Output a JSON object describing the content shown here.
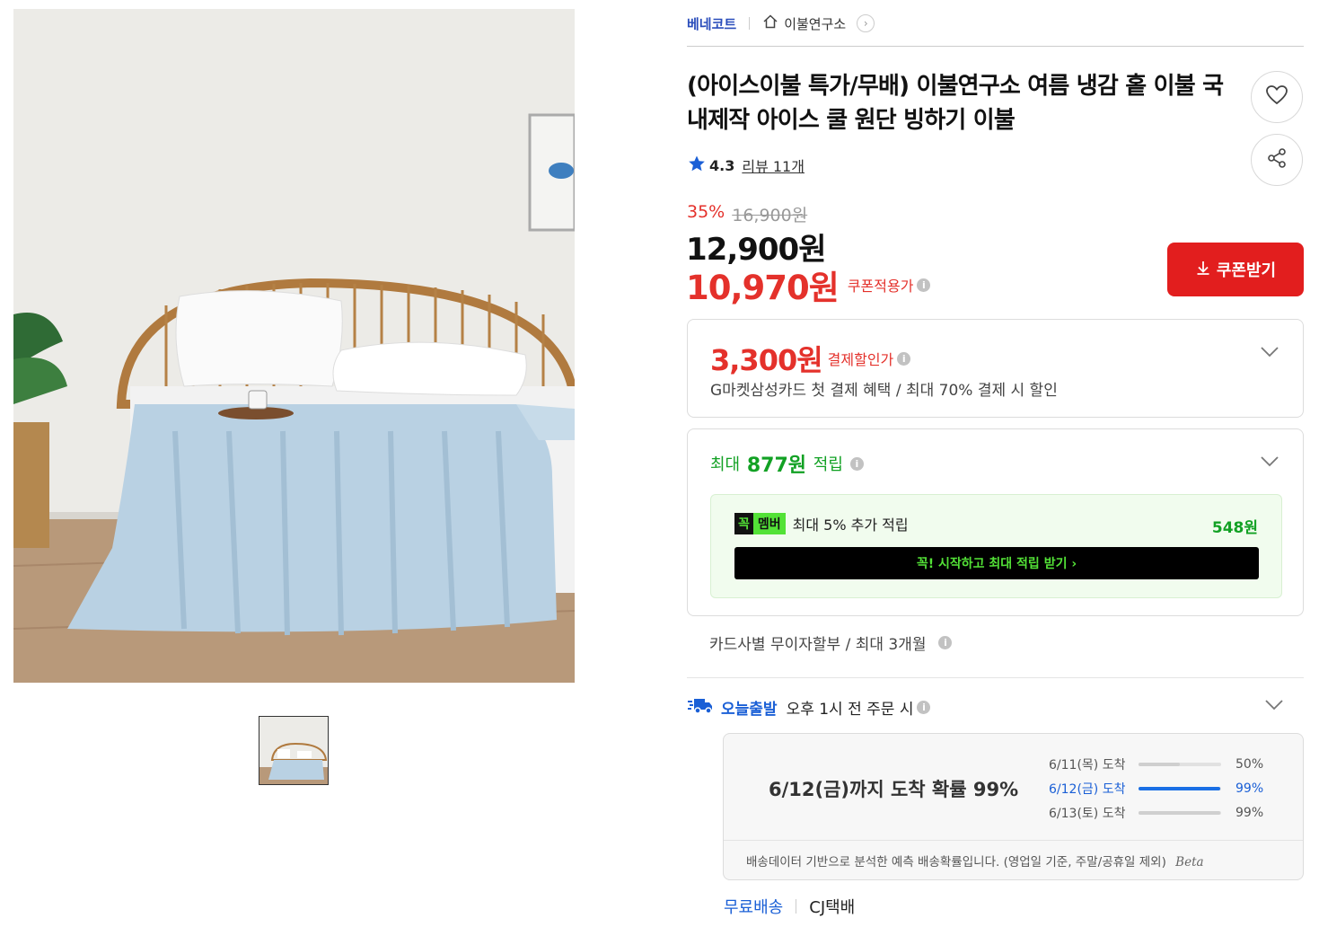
{
  "breadcrumb": {
    "brand": "베네코트",
    "store": "이불연구소",
    "arrow": "›"
  },
  "product": {
    "title": "(아이스이불 특가/무배) 이불연구소 여름 냉감 홑 이불 국내제작 아이스 쿨 원단 빙하기 이불",
    "rating": "4.3",
    "reviews": "리뷰 11개",
    "discount_rate": "35%",
    "original_price": "16,900원",
    "sale_price": "12,900원",
    "coupon_price": "10,970원",
    "coupon_label": "쿠폰적용가"
  },
  "icons": {
    "favorite": "heart-icon",
    "share": "share-icon",
    "star": "star-icon",
    "download": "download-icon",
    "info": "info-icon",
    "chevron": "chevron-down-icon",
    "truck": "fast-truck-icon",
    "home": "home-icon"
  },
  "coupon_button": {
    "label": "쿠폰받기"
  },
  "payment_discount": {
    "amount": "3,300원",
    "label": "결제할인가",
    "description": "G마켓삼성카드 첫 결제 혜택 / 최대 70% 결제 시 할인"
  },
  "points": {
    "prefix": "최대",
    "amount": "877원",
    "suffix": "적립",
    "member_badge_a": "꼭",
    "member_badge_b": "멤버",
    "member_text": "최대 5% 추가 적립",
    "member_amount": "548원",
    "member_cta": "꼭! 시작하고 최대 적립 받기  ›"
  },
  "installment": "카드사별 무이자할부 / 최대 3개월",
  "shipping": {
    "today_label": "오늘출발",
    "condition": "오후 1시 전 주문 시",
    "headline": "6/12(금)까지 도착 확률 99%",
    "arrivals": [
      {
        "date": "6/11(목) 도착",
        "percent": "50%",
        "fill": 0.5
      },
      {
        "date": "6/12(금) 도착",
        "percent": "99%",
        "fill": 0.99
      },
      {
        "date": "6/13(토) 도착",
        "percent": "99%",
        "fill": 0.99
      }
    ],
    "note": "배송데이터 기반으로 분석한 예측 배송확률입니다. (영업일 기준, 주말/공휴일 제외)",
    "beta": "Beta",
    "free": "무료배송",
    "carrier": "CJ택배"
  },
  "colors": {
    "accent_red": "#e21e1e",
    "price_red": "#e4312b",
    "link_blue": "#1a5fd6",
    "point_green": "#12a124",
    "member_green": "#53e237"
  }
}
